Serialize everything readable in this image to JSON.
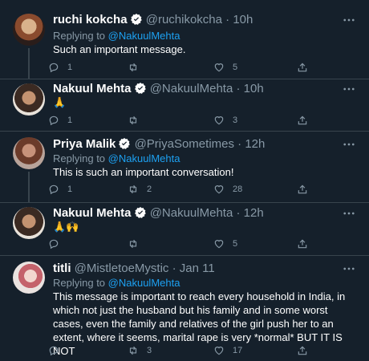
{
  "tweets": [
    {
      "name": "ruchi kokcha",
      "handle": "@ruchikokcha",
      "sep": " · ",
      "time": "10h",
      "replying_label": "Replying to ",
      "replying_to": "@NakuulMehta",
      "text": "Such an important message.",
      "replies": "1",
      "retweets": "",
      "likes": "5"
    },
    {
      "name": "Nakuul Mehta",
      "handle": "@NakuulMehta",
      "sep": " · ",
      "time": "10h",
      "text": "🙏",
      "replies": "1",
      "retweets": "",
      "likes": "3"
    },
    {
      "name": "Priya Malik",
      "handle": "@PriyaSometimes",
      "sep": " · ",
      "time": "12h",
      "replying_label": "Replying to ",
      "replying_to": "@NakuulMehta",
      "text": "This is such an important conversation!",
      "replies": "1",
      "retweets": "2",
      "likes": "28"
    },
    {
      "name": "Nakuul Mehta",
      "handle": "@NakuulMehta",
      "sep": " · ",
      "time": "12h",
      "text": "🙏🙌",
      "replies": "",
      "retweets": "",
      "likes": "5"
    },
    {
      "name": "titli",
      "handle": "@MistletoeMystic",
      "sep": " · ",
      "time": "Jan 11",
      "replying_label": "Replying to ",
      "replying_to": "@NakuulMehta",
      "text": "This message is important to reach every household in India, in which not just the husband but his family and in some worst cases, even the family and relatives of the girl push her to an extent, where it seems, marital rape is very *normal* BUT IT IS NOT",
      "replies": "",
      "retweets": "3",
      "likes": "17"
    }
  ],
  "colors": {
    "background": "#15202b",
    "secondary_text": "#8899a6",
    "link": "#1da1f2",
    "divider": "#38444d",
    "verified": "#ffffff"
  }
}
